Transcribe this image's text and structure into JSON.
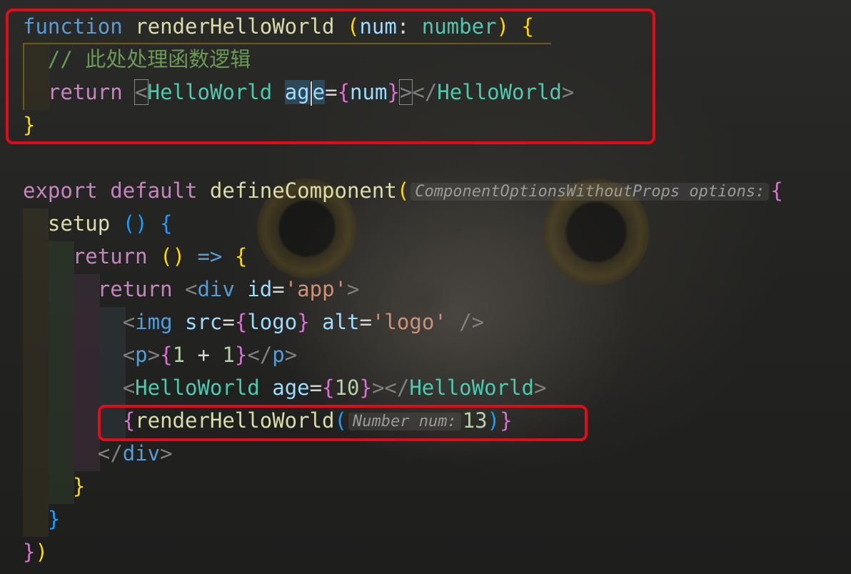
{
  "editor": {
    "lines": [
      [
        {
          "t": "function",
          "c": "kw"
        },
        {
          "t": " ",
          "c": "plain"
        },
        {
          "t": "renderHelloWorld",
          "c": "fn"
        },
        {
          "t": " ",
          "c": "plain"
        },
        {
          "t": "(",
          "c": "brace-y"
        },
        {
          "t": "num",
          "c": "param"
        },
        {
          "t": ": ",
          "c": "plain"
        },
        {
          "t": "number",
          "c": "type"
        },
        {
          "t": ")",
          "c": "brace-y"
        },
        {
          "t": " ",
          "c": "plain"
        },
        {
          "t": "{",
          "c": "brace-y"
        }
      ],
      [
        {
          "t": "  ",
          "c": "plain"
        },
        {
          "t": "// 此处处理函数逻辑",
          "c": "comment"
        }
      ],
      [
        {
          "t": "  ",
          "c": "plain"
        },
        {
          "t": "return",
          "c": "ctl"
        },
        {
          "t": " ",
          "c": "plain"
        },
        {
          "t": "<",
          "c": "punct",
          "m": "bracket"
        },
        {
          "t": "HelloWorld",
          "c": "comp"
        },
        {
          "t": " ",
          "c": "plain"
        },
        {
          "t": "ag",
          "c": "attr",
          "m": "word"
        },
        {
          "t": "",
          "c": "plain",
          "m": "cursor"
        },
        {
          "t": "e",
          "c": "attr",
          "m": "word"
        },
        {
          "t": "=",
          "c": "plain"
        },
        {
          "t": "{",
          "c": "brace-p"
        },
        {
          "t": "num",
          "c": "param"
        },
        {
          "t": "}",
          "c": "brace-p"
        },
        {
          "t": ">",
          "c": "punct",
          "m": "bracket"
        },
        {
          "t": "</",
          "c": "punct"
        },
        {
          "t": "HelloWorld",
          "c": "comp"
        },
        {
          "t": ">",
          "c": "punct"
        }
      ],
      [
        {
          "t": "}",
          "c": "brace-y"
        }
      ],
      [],
      [
        {
          "t": "export",
          "c": "ctl"
        },
        {
          "t": " ",
          "c": "plain"
        },
        {
          "t": "default",
          "c": "ctl"
        },
        {
          "t": " ",
          "c": "plain"
        },
        {
          "t": "defineComponent",
          "c": "fn"
        },
        {
          "t": "(",
          "c": "brace-y"
        },
        {
          "t": "ComponentOptionsWithoutProps options:",
          "c": "hint"
        },
        {
          "t": "{",
          "c": "brace-p"
        }
      ],
      [
        {
          "t": "  ",
          "c": "plain"
        },
        {
          "t": "setup",
          "c": "fn"
        },
        {
          "t": " ",
          "c": "plain"
        },
        {
          "t": "()",
          "c": "brace-b"
        },
        {
          "t": " ",
          "c": "plain"
        },
        {
          "t": "{",
          "c": "brace-b"
        }
      ],
      [
        {
          "t": "    ",
          "c": "plain"
        },
        {
          "t": "return",
          "c": "ctl"
        },
        {
          "t": " ",
          "c": "plain"
        },
        {
          "t": "()",
          "c": "brace-y"
        },
        {
          "t": " ",
          "c": "plain"
        },
        {
          "t": "=>",
          "c": "kw"
        },
        {
          "t": " ",
          "c": "plain"
        },
        {
          "t": "{",
          "c": "brace-y"
        }
      ],
      [
        {
          "t": "      ",
          "c": "plain"
        },
        {
          "t": "return",
          "c": "ctl"
        },
        {
          "t": " ",
          "c": "plain"
        },
        {
          "t": "<",
          "c": "punct"
        },
        {
          "t": "div",
          "c": "tag"
        },
        {
          "t": " ",
          "c": "plain"
        },
        {
          "t": "id",
          "c": "attr"
        },
        {
          "t": "=",
          "c": "plain"
        },
        {
          "t": "'app'",
          "c": "str"
        },
        {
          "t": ">",
          "c": "punct"
        }
      ],
      [
        {
          "t": "        ",
          "c": "plain"
        },
        {
          "t": "<",
          "c": "punct"
        },
        {
          "t": "img",
          "c": "tag"
        },
        {
          "t": " ",
          "c": "plain"
        },
        {
          "t": "src",
          "c": "attr"
        },
        {
          "t": "=",
          "c": "plain"
        },
        {
          "t": "{",
          "c": "brace-p"
        },
        {
          "t": "logo",
          "c": "param"
        },
        {
          "t": "}",
          "c": "brace-p"
        },
        {
          "t": " ",
          "c": "plain"
        },
        {
          "t": "alt",
          "c": "attr"
        },
        {
          "t": "=",
          "c": "plain"
        },
        {
          "t": "'logo'",
          "c": "str"
        },
        {
          "t": " ",
          "c": "plain"
        },
        {
          "t": "/>",
          "c": "punct"
        }
      ],
      [
        {
          "t": "        ",
          "c": "plain"
        },
        {
          "t": "<",
          "c": "punct"
        },
        {
          "t": "p",
          "c": "tag"
        },
        {
          "t": ">",
          "c": "punct"
        },
        {
          "t": "{",
          "c": "brace-p"
        },
        {
          "t": "1",
          "c": "num"
        },
        {
          "t": " + ",
          "c": "plain"
        },
        {
          "t": "1",
          "c": "num"
        },
        {
          "t": "}",
          "c": "brace-p"
        },
        {
          "t": "</",
          "c": "punct"
        },
        {
          "t": "p",
          "c": "tag"
        },
        {
          "t": ">",
          "c": "punct"
        }
      ],
      [
        {
          "t": "        ",
          "c": "plain"
        },
        {
          "t": "<",
          "c": "punct"
        },
        {
          "t": "HelloWorld",
          "c": "comp"
        },
        {
          "t": " ",
          "c": "plain"
        },
        {
          "t": "age",
          "c": "attr"
        },
        {
          "t": "=",
          "c": "plain"
        },
        {
          "t": "{",
          "c": "brace-p"
        },
        {
          "t": "10",
          "c": "num"
        },
        {
          "t": "}",
          "c": "brace-p"
        },
        {
          "t": "></",
          "c": "punct"
        },
        {
          "t": "HelloWorld",
          "c": "comp"
        },
        {
          "t": ">",
          "c": "punct"
        }
      ],
      [
        {
          "t": "        ",
          "c": "plain"
        },
        {
          "t": "{",
          "c": "brace-p"
        },
        {
          "t": "renderHelloWorld",
          "c": "fn"
        },
        {
          "t": "(",
          "c": "brace-b"
        },
        {
          "t": "Number num:",
          "c": "hint"
        },
        {
          "t": "13",
          "c": "num"
        },
        {
          "t": ")",
          "c": "brace-b"
        },
        {
          "t": "}",
          "c": "brace-p"
        }
      ],
      [
        {
          "t": "      ",
          "c": "plain"
        },
        {
          "t": "</",
          "c": "punct"
        },
        {
          "t": "div",
          "c": "tag"
        },
        {
          "t": ">",
          "c": "punct"
        }
      ],
      [
        {
          "t": "    ",
          "c": "plain"
        },
        {
          "t": "}",
          "c": "brace-y"
        }
      ],
      [
        {
          "t": "  ",
          "c": "plain"
        },
        {
          "t": "}",
          "c": "brace-b"
        }
      ],
      [
        {
          "t": "}",
          "c": "brace-p"
        },
        {
          "t": ")",
          "c": "brace-y"
        }
      ]
    ],
    "highlight_boxes": [
      {
        "label": "function-definition-block"
      },
      {
        "label": "function-call-line"
      }
    ]
  }
}
